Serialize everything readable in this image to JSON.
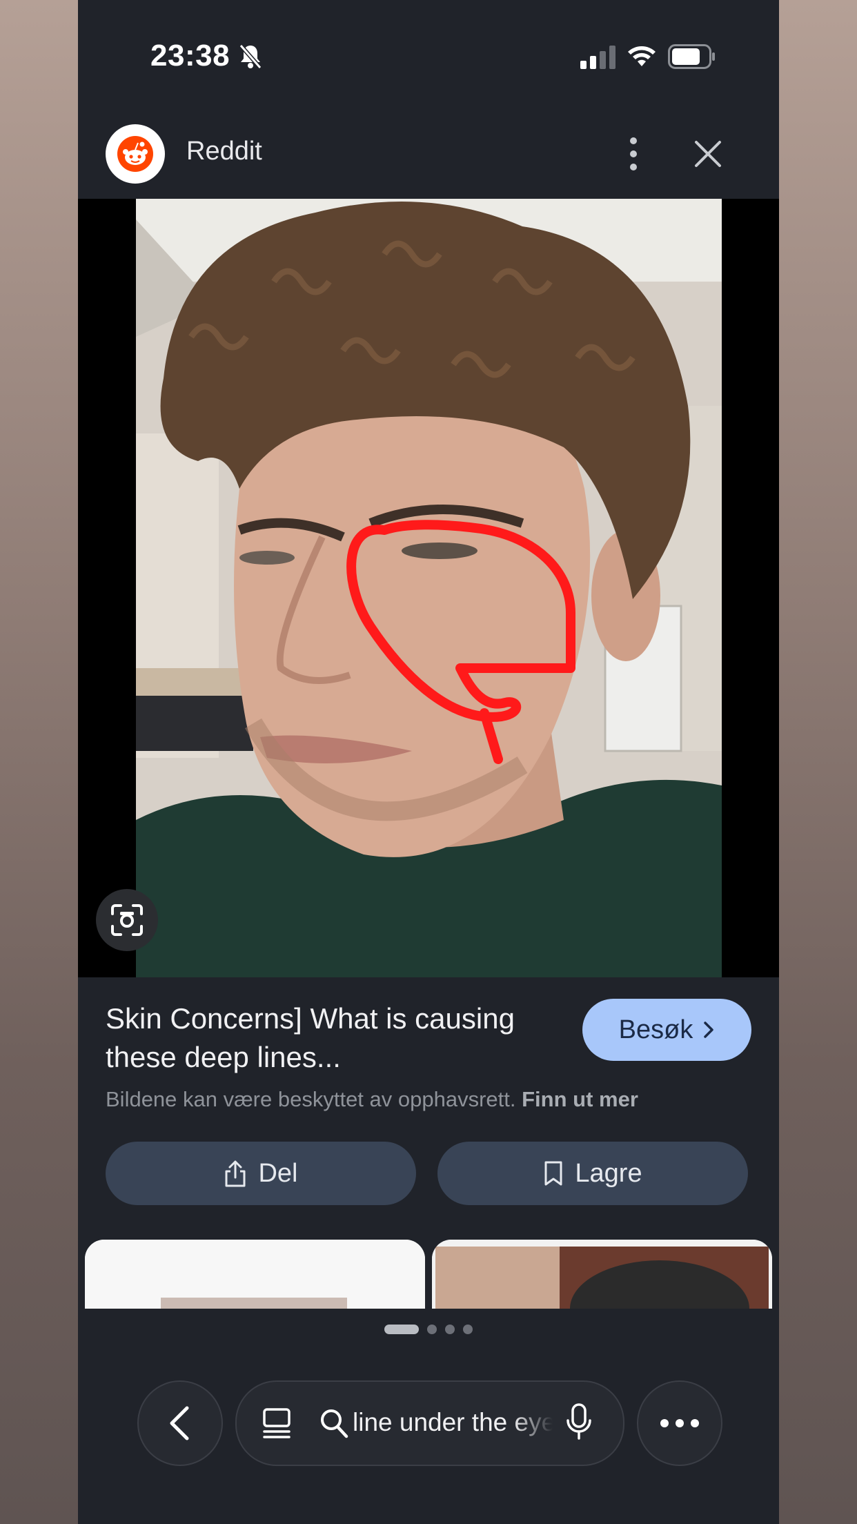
{
  "status_bar": {
    "time": "23:38"
  },
  "header": {
    "source_name": "Reddit"
  },
  "result": {
    "title": "Skin Concerns] What is causing these deep lines...",
    "visit_label": "Besøk",
    "copyright_text": "Bildene kan være beskyttet av opphavsrett.",
    "learn_more_label": "Finn ut mer"
  },
  "actions": {
    "share_label": "Del",
    "save_label": "Lagre"
  },
  "search": {
    "query": "line under the eye"
  },
  "pagination": {
    "total": 4,
    "active": 1
  },
  "icons": [
    "bell-muted-icon",
    "signal-icon",
    "wifi-icon",
    "battery-icon",
    "reddit-logo",
    "more-vert-icon",
    "close-icon",
    "lens-icon",
    "chevron-right-icon",
    "share-icon",
    "bookmark-icon",
    "chevron-left-icon",
    "tabs-icon",
    "search-icon",
    "mic-icon",
    "more-horiz-icon"
  ],
  "colors": {
    "accent_button": "#a8c7fa",
    "action_button": "#394456",
    "background": "#20232a",
    "annotation": "#ff1a1a"
  }
}
